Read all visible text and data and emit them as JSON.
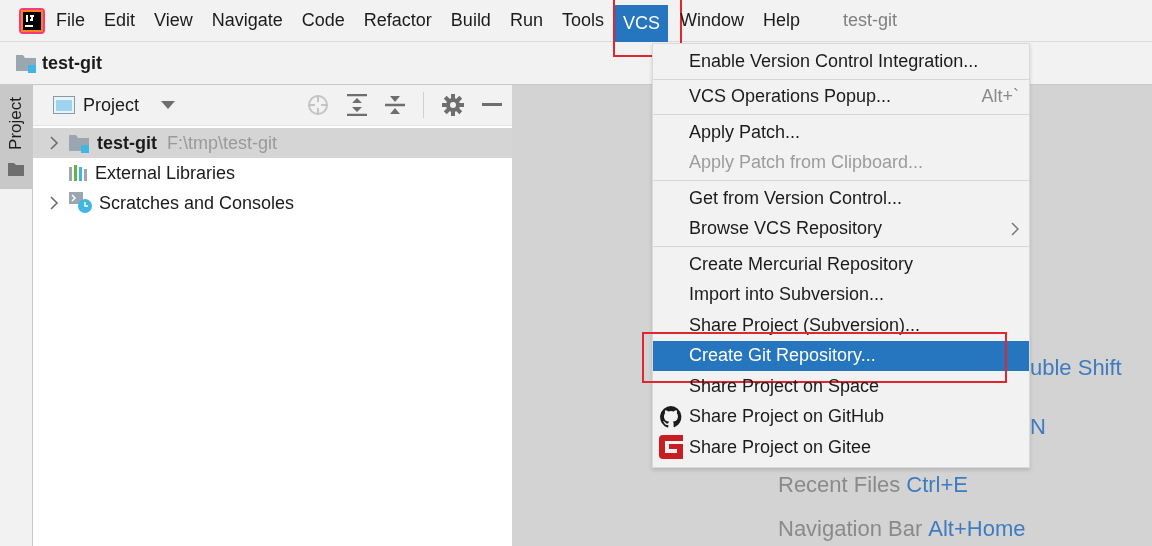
{
  "menubar": {
    "items": [
      {
        "label": "File",
        "selected": false,
        "outlined": false
      },
      {
        "label": "Edit",
        "selected": false,
        "outlined": false
      },
      {
        "label": "View",
        "selected": false,
        "outlined": false
      },
      {
        "label": "Navigate",
        "selected": false,
        "outlined": false
      },
      {
        "label": "Code",
        "selected": false,
        "outlined": false
      },
      {
        "label": "Refactor",
        "selected": false,
        "outlined": false
      },
      {
        "label": "Build",
        "selected": false,
        "outlined": false
      },
      {
        "label": "Run",
        "selected": false,
        "outlined": false
      },
      {
        "label": "Tools",
        "selected": false,
        "outlined": false
      },
      {
        "label": "VCS",
        "selected": true,
        "outlined": true
      },
      {
        "label": "Window",
        "selected": false,
        "outlined": false
      },
      {
        "label": "Help",
        "selected": false,
        "outlined": false
      }
    ],
    "project_title": "test-git"
  },
  "breadcrumb": {
    "label": "test-git"
  },
  "side_tab": {
    "label": "Project",
    "selected": true
  },
  "project_panel": {
    "view": "Project",
    "tree": [
      {
        "label": "test-git",
        "path": "F:\\tmp\\test-git",
        "kind": "project",
        "expanded": false,
        "selected": true
      },
      {
        "label": "External Libraries",
        "kind": "libraries",
        "selected": false
      },
      {
        "label": "Scratches and Consoles",
        "kind": "scratches",
        "expanded": false,
        "selected": false
      }
    ]
  },
  "editor_hints": [
    {
      "key": "uble Shift"
    },
    {
      "key": "N"
    },
    {
      "label": "Recent Files",
      "key": "Ctrl+E"
    },
    {
      "label": "Navigation Bar",
      "key": "Alt+Home"
    }
  ],
  "vcs_menu": {
    "groups": [
      {
        "items": [
          {
            "kind": "plain",
            "label": "Enable Version Control Integration...",
            "disabled": false,
            "selected": false,
            "outlined": false
          }
        ]
      },
      {
        "items": [
          {
            "kind": "plain",
            "label": "VCS Operations Popup...",
            "shortcut": "Alt+`",
            "disabled": false,
            "selected": false,
            "outlined": false
          }
        ]
      },
      {
        "items": [
          {
            "kind": "plain",
            "label": "Apply Patch...",
            "disabled": false,
            "selected": false,
            "outlined": false
          },
          {
            "kind": "plain",
            "label": "Apply Patch from Clipboard...",
            "disabled": true,
            "selected": false,
            "outlined": false
          }
        ]
      },
      {
        "items": [
          {
            "kind": "plain",
            "label": "Get from Version Control...",
            "disabled": false,
            "selected": false,
            "outlined": false
          },
          {
            "kind": "plain",
            "label": "Browse VCS Repository",
            "submenu": true,
            "disabled": false,
            "selected": false,
            "outlined": false
          }
        ]
      },
      {
        "items": [
          {
            "kind": "plain",
            "label": "Create Mercurial Repository",
            "disabled": false,
            "selected": false,
            "outlined": false
          },
          {
            "kind": "plain",
            "label": "Import into Subversion...",
            "disabled": false,
            "selected": false,
            "outlined": false
          },
          {
            "kind": "plain",
            "label": "Share Project (Subversion)...",
            "disabled": false,
            "selected": false,
            "outlined": false
          },
          {
            "kind": "plain",
            "label": "Create Git Repository...",
            "disabled": false,
            "selected": true,
            "outlined": true
          },
          {
            "kind": "plain",
            "label": "Share Project on Space",
            "disabled": false,
            "selected": false,
            "outlined": false
          },
          {
            "kind": "github",
            "label": "Share Project on GitHub",
            "disabled": false,
            "selected": false,
            "outlined": false
          },
          {
            "kind": "gitee",
            "label": "Share Project on Gitee",
            "disabled": false,
            "selected": false,
            "outlined": false
          }
        ]
      }
    ]
  }
}
